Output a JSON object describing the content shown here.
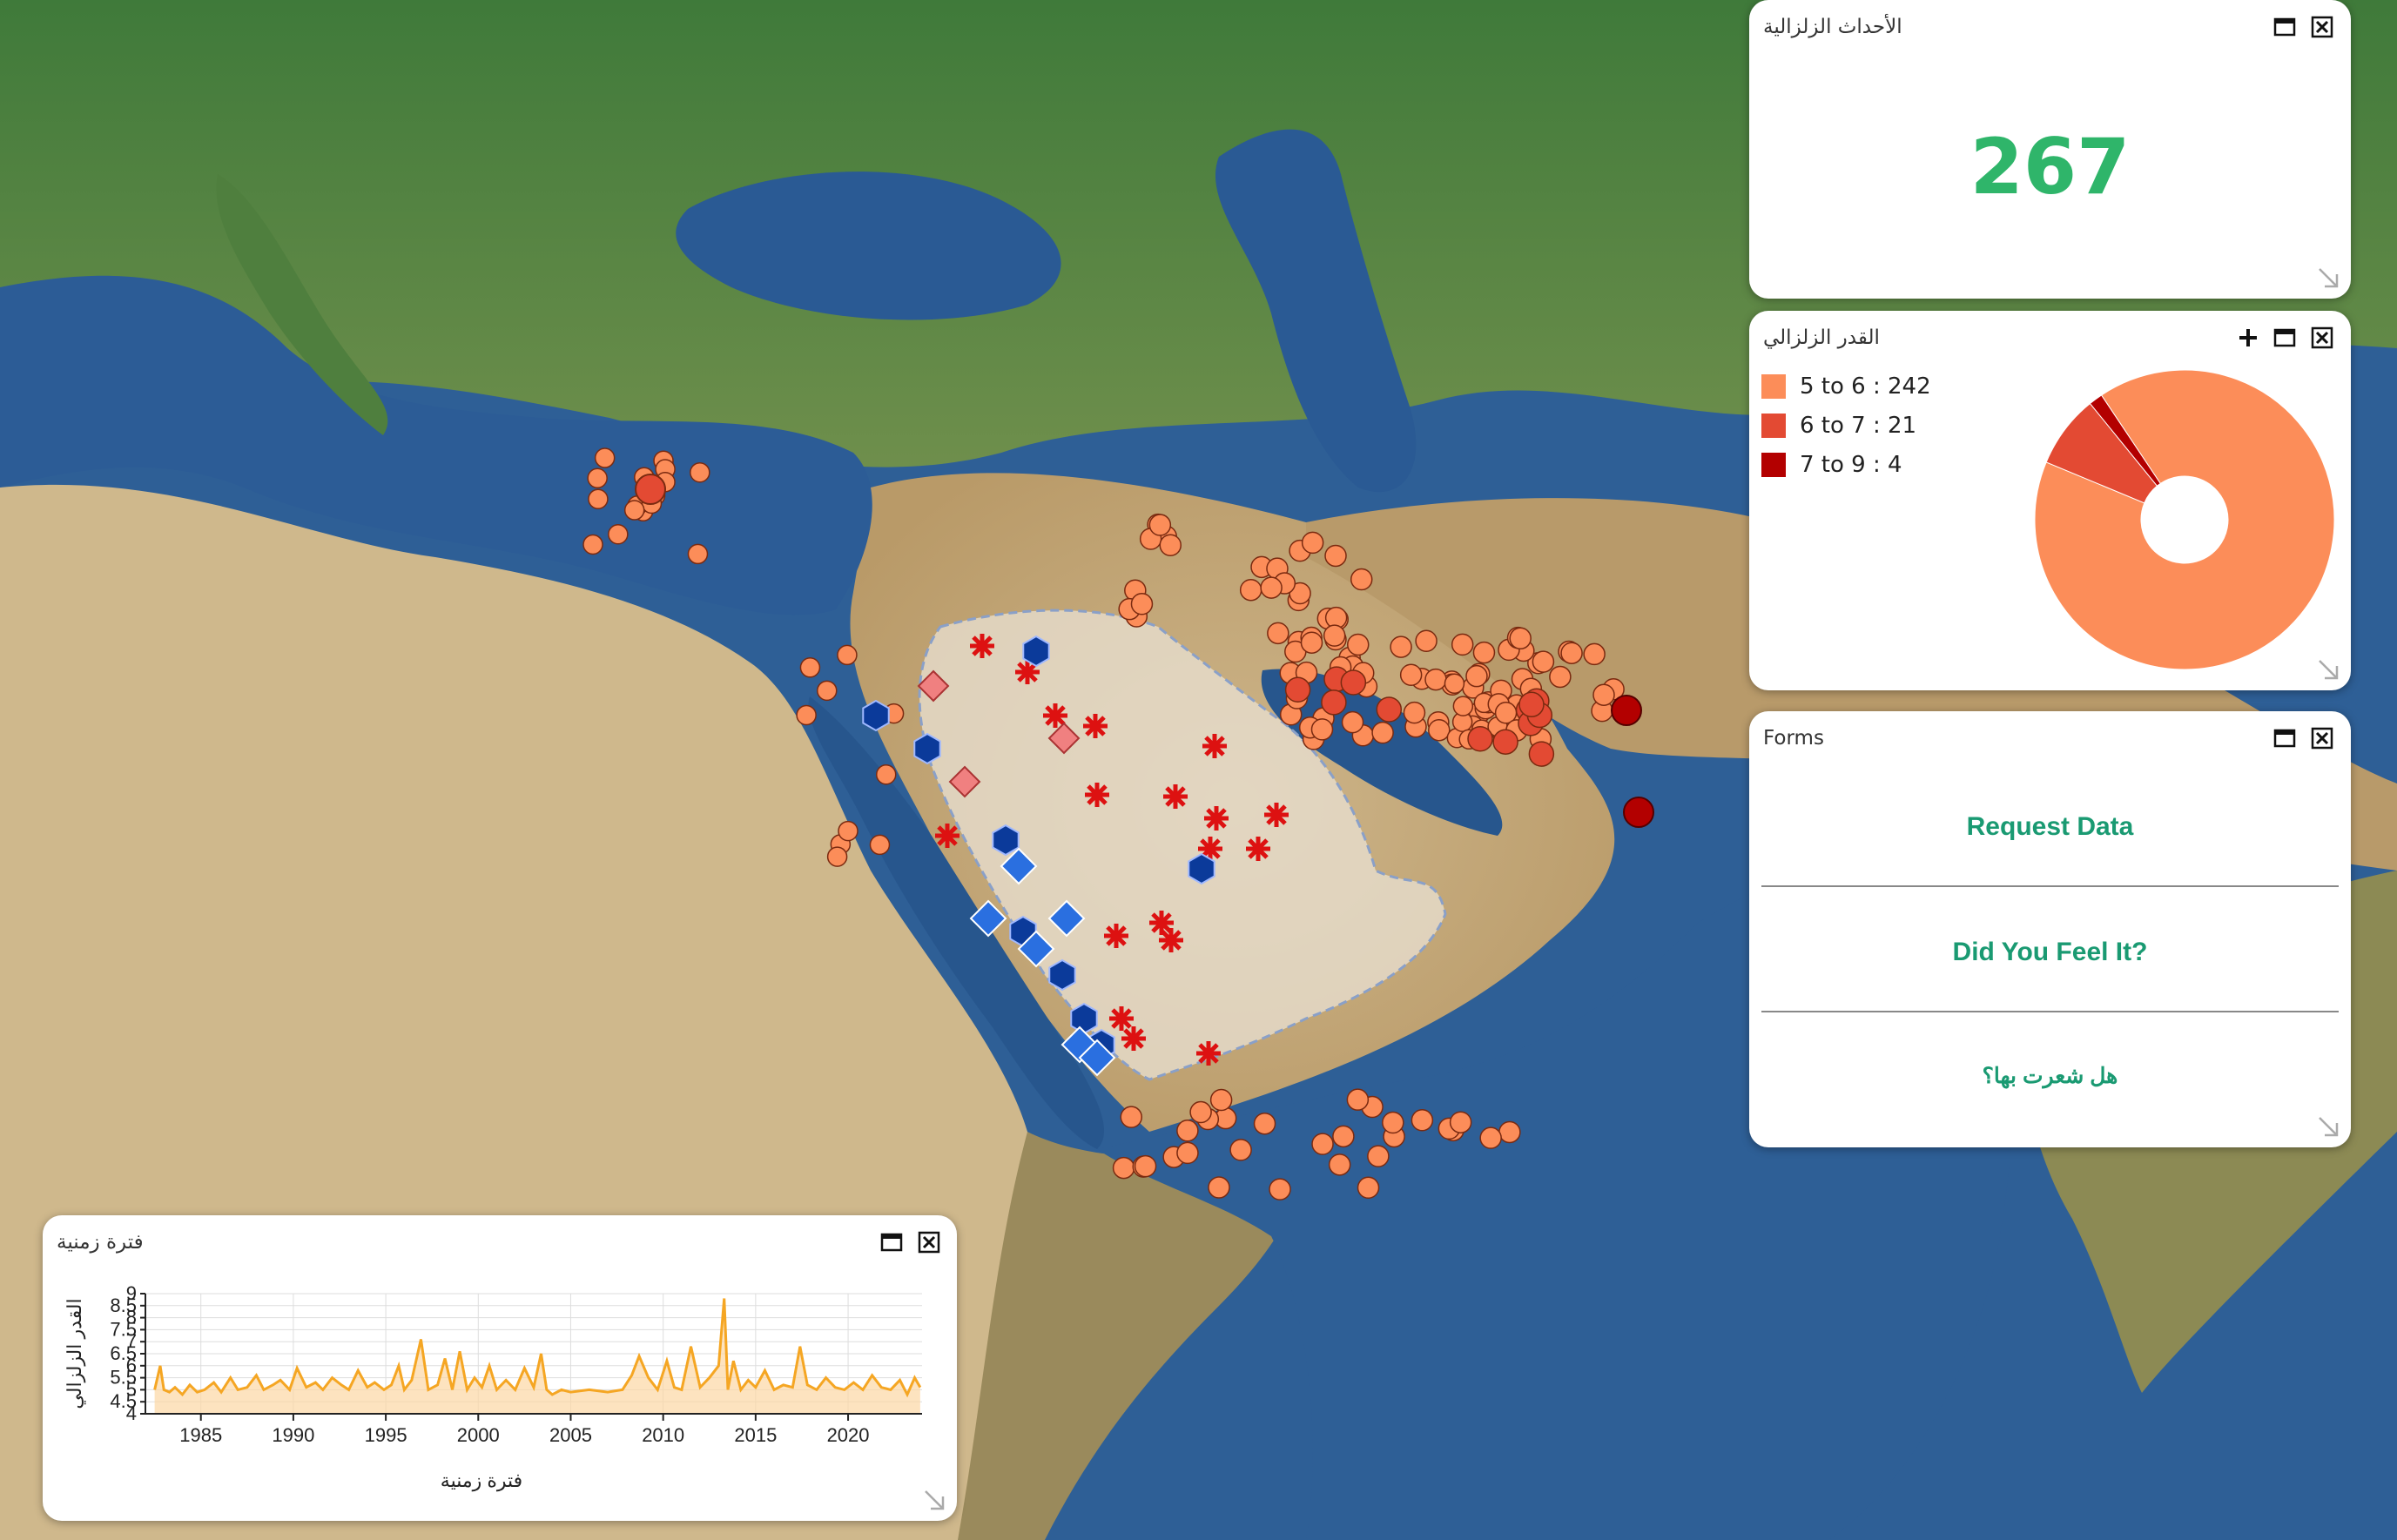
{
  "colors": {
    "accent_green": "#2fb56a",
    "link_green": "#1a9a72",
    "mag_5_6": "#fc8d59",
    "mag_6_7": "#e34a33",
    "mag_7_9": "#b30000",
    "timeline_line": "#f5a623"
  },
  "icons": [
    "maximize-icon",
    "close-icon",
    "plus-icon",
    "resize-corner-icon",
    "earthquake-marker-icon",
    "volcano-marker-icon",
    "station-marker-icon"
  ],
  "count_panel": {
    "title": "الأحداث الزلزالية",
    "value": "267"
  },
  "magnitude_panel": {
    "title": "القدر الزلزالي",
    "legend": [
      {
        "label": "5 to 6 : 242",
        "color": "#fc8d59"
      },
      {
        "label": "6 to 7 : 21",
        "color": "#e34a33"
      },
      {
        "label": "7 to 9 : 4",
        "color": "#b30000"
      }
    ]
  },
  "forms_panel": {
    "title": "Forms",
    "links": [
      "Request Data",
      "Did You Feel It?",
      "هل شعرت بها؟"
    ]
  },
  "timeline_panel": {
    "title": "فترة زمنية"
  },
  "chart_data": [
    {
      "type": "pie",
      "categories": [
        "5 to 6",
        "6 to 7",
        "7 to 9"
      ],
      "values": [
        242,
        21,
        4
      ],
      "colors": [
        "#fc8d59",
        "#e34a33",
        "#b30000"
      ],
      "donut": true,
      "legend": "left"
    },
    {
      "type": "area",
      "xlabel": "فترة زمنية",
      "ylabel": "القدر الزلزالي",
      "xlim": [
        1982,
        2024
      ],
      "ylim": [
        4,
        9
      ],
      "xticks": [
        "1985",
        "1990",
        "1995",
        "2000",
        "2005",
        "2010",
        "2015",
        "2020"
      ],
      "yticks": [
        "4",
        "4.5",
        "5",
        "5.5",
        "6",
        "6.5",
        "7",
        "7.5",
        "8",
        "8.5",
        "9"
      ],
      "grid": true,
      "series": [
        {
          "x": [
            1982.5,
            1982.8,
            1983.0,
            1983.3,
            1983.6,
            1984.0,
            1984.4,
            1984.8,
            1985.2,
            1985.7,
            1986.1,
            1986.6,
            1987.0,
            1987.5,
            1988.0,
            1988.4,
            1988.9,
            1989.3,
            1989.8,
            1990.2,
            1990.7,
            1991.2,
            1991.6,
            1992.1,
            1992.6,
            1993.0,
            1993.5,
            1994.0,
            1994.4,
            1994.9,
            1995.3,
            1995.7,
            1996.0,
            1996.4,
            1996.9,
            1997.3,
            1997.8,
            1998.2,
            1998.6,
            1999.0,
            1999.4,
            1999.8,
            2000.2,
            2000.6,
            2001.0,
            2001.5,
            2002.0,
            2002.5,
            2003.0,
            2003.4,
            2003.7,
            2004.0,
            2004.5,
            2005.0,
            2006.0,
            2007.0,
            2007.8,
            2008.3,
            2008.7,
            2009.2,
            2009.7,
            2010.2,
            2010.6,
            2011.0,
            2011.5,
            2012.0,
            2012.5,
            2013.0,
            2013.3,
            2013.5,
            2013.8,
            2014.2,
            2014.6,
            2015.0,
            2015.5,
            2016.0,
            2016.5,
            2017.0,
            2017.4,
            2017.8,
            2018.3,
            2018.8,
            2019.3,
            2019.8,
            2020.3,
            2020.8,
            2021.3,
            2021.8,
            2022.3,
            2022.8,
            2023.2,
            2023.6,
            2023.9
          ],
          "y": [
            5.0,
            6.0,
            5.0,
            4.9,
            5.1,
            4.8,
            5.2,
            4.9,
            5.0,
            5.3,
            4.9,
            5.5,
            5.0,
            5.1,
            5.6,
            5.0,
            5.2,
            5.4,
            5.0,
            5.9,
            5.1,
            5.3,
            5.0,
            5.5,
            5.2,
            5.0,
            5.8,
            5.1,
            5.3,
            5.0,
            5.2,
            6.0,
            5.0,
            5.4,
            7.1,
            5.0,
            5.2,
            6.3,
            5.0,
            6.6,
            5.0,
            5.5,
            5.1,
            6.0,
            5.0,
            5.4,
            5.0,
            5.9,
            5.1,
            6.5,
            5.0,
            4.8,
            5.0,
            4.9,
            5.0,
            4.9,
            5.0,
            5.6,
            6.4,
            5.5,
            5.0,
            6.2,
            5.1,
            5.0,
            6.8,
            5.1,
            5.5,
            6.0,
            8.8,
            5.0,
            6.2,
            5.0,
            5.4,
            5.1,
            5.8,
            5.0,
            5.2,
            5.1,
            6.8,
            5.2,
            5.0,
            5.5,
            5.1,
            5.0,
            5.3,
            5.0,
            5.6,
            5.1,
            5.0,
            5.4,
            4.8,
            5.5,
            5.1
          ]
        }
      ]
    }
  ]
}
